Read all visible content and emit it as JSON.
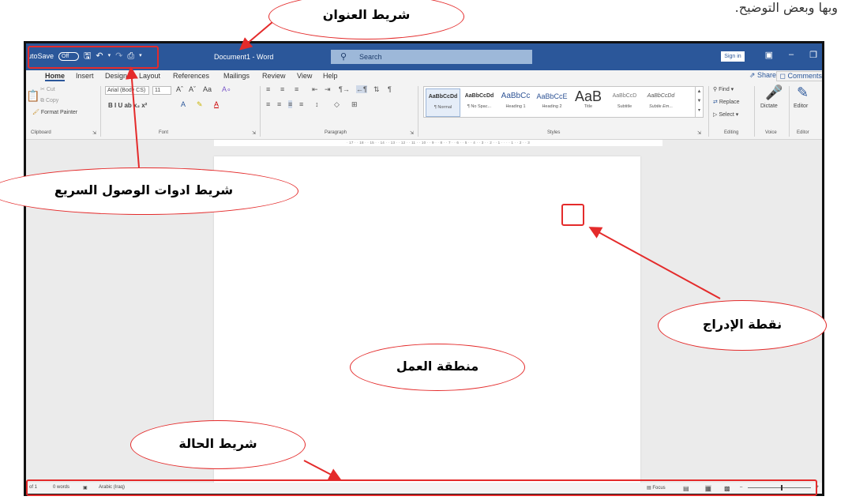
{
  "top_text": "وبها وبعض التوضيح.",
  "title_bar": {
    "autosave_label": "utoSave",
    "autosave_state": "Off",
    "document_title": "Document1 - Word",
    "search_placeholder": "Search",
    "signin_label": "Sign in",
    "qa_icons": [
      "save-icon",
      "undo-icon",
      "redo-icon",
      "print-preview-icon",
      "customize-dropdown-icon"
    ]
  },
  "tabs": {
    "items": [
      "Home",
      "Insert",
      "Design",
      "Layout",
      "References",
      "Mailings",
      "Review",
      "View",
      "Help"
    ],
    "share_label": "Share",
    "comments_label": "Comments"
  },
  "ribbon": {
    "clipboard": {
      "cut": "Cut",
      "copy": "Copy",
      "format_painter": "Format Painter",
      "label": "Clipboard"
    },
    "font": {
      "font_name": "Arial (Body CS)",
      "font_size": "11",
      "case_label": "Aa",
      "row2": "B  I  U  ab  x₂  x²",
      "label": "Font"
    },
    "paragraph": {
      "label": "Paragraph"
    },
    "styles": {
      "items": [
        {
          "sample": "AaBbCcDd",
          "name": "¶ Normal"
        },
        {
          "sample": "AaBbCcDd",
          "name": "¶ No Spac..."
        },
        {
          "sample": "AaBbCc",
          "name": "Heading 1"
        },
        {
          "sample": "AaBbCcE",
          "name": "Heading 2"
        },
        {
          "sample": "AaB",
          "name": "Title"
        },
        {
          "sample": "AaBbCcD",
          "name": "Subtitle"
        },
        {
          "sample": "AaBbCcDd",
          "name": "Subtle Em..."
        }
      ],
      "label": "Styles"
    },
    "editing": {
      "find": "Find",
      "replace": "Replace",
      "select": "Select",
      "label": "Editing"
    },
    "voice": {
      "dictate": "Dictate",
      "label": "Voice"
    },
    "editor": {
      "editor": "Editor",
      "label": "Editor"
    }
  },
  "ruler_text": "· 17 · · 18 · · 15 · · 14 · · 13 · · 12 · · 11 · · 10 · · 9 · · 8 · · 7 · · 6 · · 5 · · 4 · · 3 · · 2 · · 1 · · · · 1 · · 2 · · 3",
  "status_bar": {
    "page": "of 1",
    "words": "0 words",
    "language": "Arabic (Iraq)",
    "focus": "Focus"
  },
  "annotations": {
    "title_bar": "شريط العنوان",
    "quick_access": "شريط ادوات الوصول السريع",
    "insertion_point": "نقطة الإدراج",
    "work_area": "منطقة العمل",
    "status_bar": "شريط الحالة"
  },
  "colors": {
    "title_bar": "#2b579a",
    "annotation": "#e42b2b"
  }
}
